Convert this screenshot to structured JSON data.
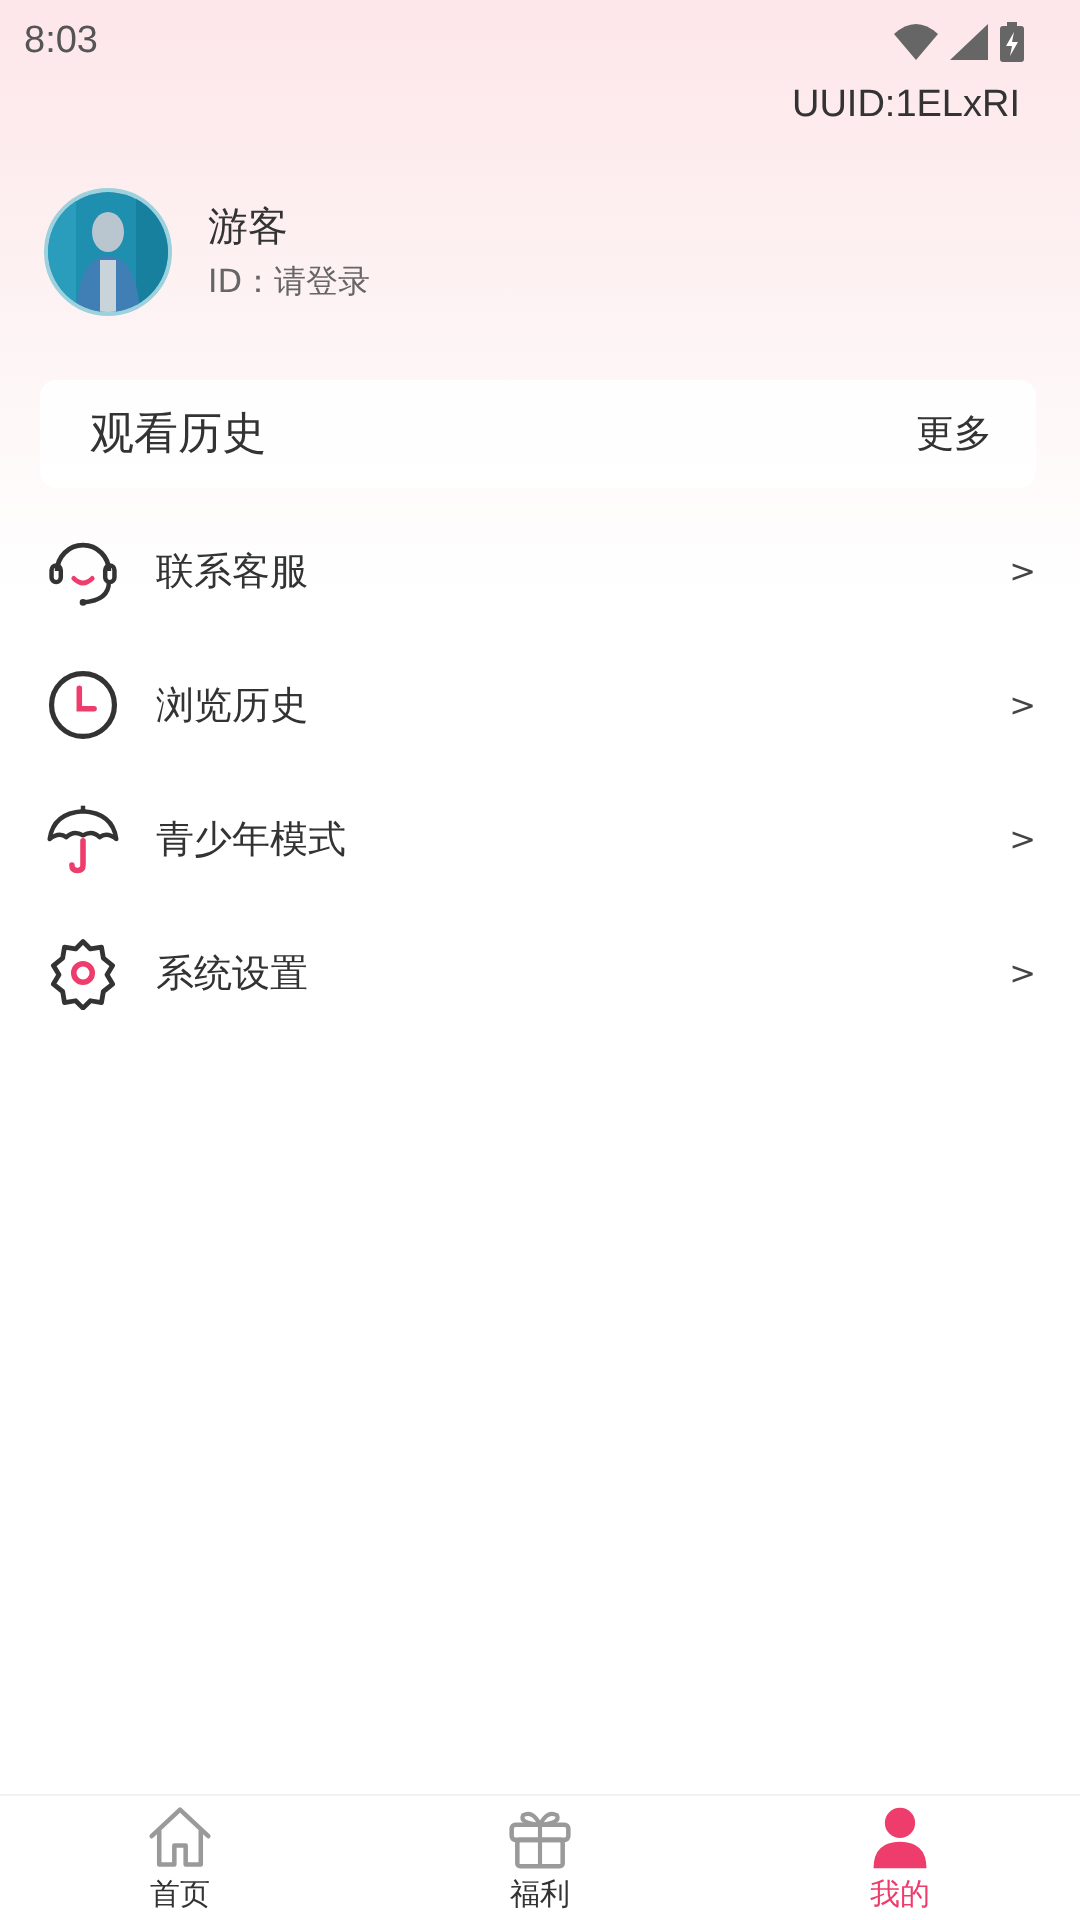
{
  "status_bar": {
    "time": "8:03"
  },
  "uuid": "UUID:1ELxRI",
  "profile": {
    "name": "游客",
    "id_text": "ID：请登录"
  },
  "history_card": {
    "title": "观看历史",
    "more": "更多"
  },
  "menu": [
    {
      "kind": "headset",
      "label": "联系客服",
      "arrow": ">"
    },
    {
      "kind": "clock",
      "label": "浏览历史",
      "arrow": ">"
    },
    {
      "kind": "umbrella",
      "label": "青少年模式",
      "arrow": ">"
    },
    {
      "kind": "gear",
      "label": "系统设置",
      "arrow": ">"
    }
  ],
  "tabs": [
    {
      "kind": "home",
      "label": "首页",
      "selected": false
    },
    {
      "kind": "gift",
      "label": "福利",
      "selected": false
    },
    {
      "kind": "person",
      "label": "我的",
      "selected": true
    }
  ]
}
